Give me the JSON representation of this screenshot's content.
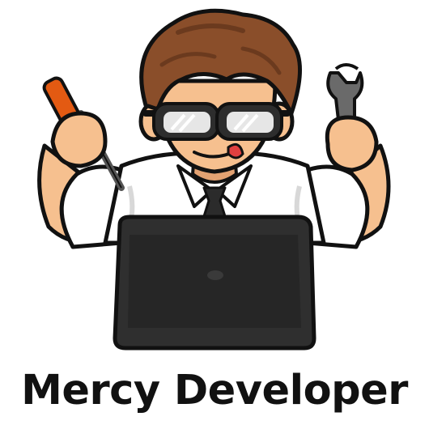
{
  "caption": "Mercy Developer",
  "colors": {
    "skin": "#f6c08f",
    "skin_shadow": "#e3a272",
    "hair": "#8a4e2a",
    "hair_dark": "#6b3a1e",
    "outline": "#111111",
    "glasses_frame": "#2d2d2d",
    "lens": "#e6e6e6",
    "shirt": "#ffffff",
    "shirt_shadow": "#d8d8d8",
    "tie": "#2b2b2b",
    "laptop": "#2f2f2f",
    "laptop_shade": "#262626",
    "screwdriver_handle": "#e35a12",
    "screwdriver_shaft": "#555555",
    "wrench": "#6a6a6a",
    "tongue": "#e04040",
    "caption_text": "#111111"
  },
  "icons": [
    "developer-mascot",
    "screwdriver-icon",
    "wrench-icon",
    "laptop-icon",
    "glasses-icon"
  ]
}
